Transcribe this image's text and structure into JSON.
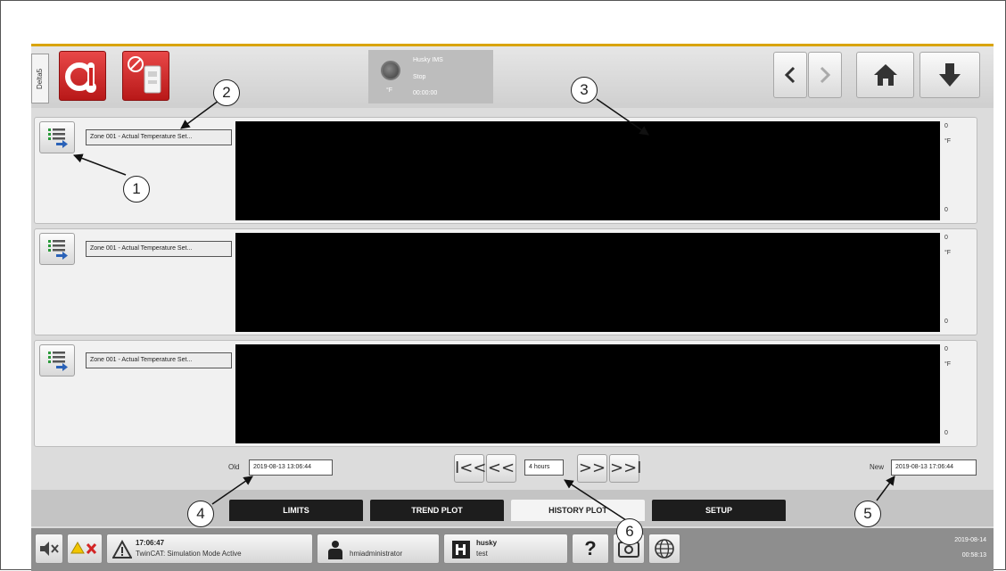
{
  "header": {
    "side_tab": "Delta5",
    "status": {
      "machine": "Husky IMS",
      "state": "Stop",
      "time": "00:00:00",
      "unit": "°F"
    }
  },
  "rows": [
    {
      "label": "Zone 001 - Actual Temperature Set...",
      "axis_top": "0",
      "axis_unit": "°F",
      "axis_bottom": "0"
    },
    {
      "label": "Zone 001 - Actual Temperature Set...",
      "axis_top": "0",
      "axis_unit": "°F",
      "axis_bottom": "0"
    },
    {
      "label": "Zone 001 - Actual Temperature Set...",
      "axis_top": "0",
      "axis_unit": "°F",
      "axis_bottom": "0"
    }
  ],
  "time_nav": {
    "old_label": "Old",
    "old_value": "2019-08-13 13:06:44",
    "range": "4 hours",
    "new_label": "New",
    "new_value": "2019-08-13 17:06:44",
    "buttons": [
      "I<<",
      "<<",
      ">>",
      ">>I"
    ]
  },
  "tabs": [
    {
      "label": "LIMITS",
      "active": false
    },
    {
      "label": "TREND PLOT",
      "active": false
    },
    {
      "label": "HISTORY PLOT",
      "active": true
    },
    {
      "label": "SETUP",
      "active": false
    }
  ],
  "footer": {
    "alarm_time": "17:06:47",
    "alarm_text": "TwinCAT: Simulation Mode Active",
    "user": "hmiadministrator",
    "mold_name": "husky",
    "mold_sub": "test",
    "help": "?",
    "date": "2019-08-14",
    "clock": "00:58:13"
  },
  "callouts": [
    "1",
    "2",
    "3",
    "4",
    "5",
    "6"
  ],
  "colors": {
    "accent_red": "#d32525",
    "top_border": "#d9a400",
    "plot_bg": "#000000",
    "active_tab": "#f4f4f4",
    "inactive_tab": "#1d1d1d"
  },
  "icons": [
    "temperature-alarm-icon",
    "manual-mode-icon",
    "arrow-left-icon",
    "arrow-right-icon",
    "home-icon",
    "download-icon",
    "list-arrow-icon",
    "mute-icon",
    "warning-icon",
    "user-icon",
    "mold-icon",
    "camera-icon",
    "globe-icon"
  ]
}
